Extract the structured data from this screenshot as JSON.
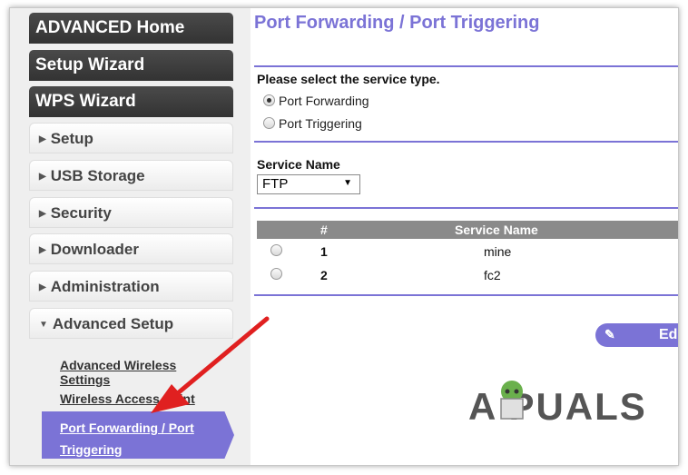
{
  "sidebar": {
    "top_buttons": [
      "ADVANCED Home",
      "Setup Wizard",
      "WPS Wizard"
    ],
    "menu": [
      "Setup",
      "USB Storage",
      "Security",
      "Downloader",
      "Administration"
    ],
    "advanced_setup": "Advanced Setup",
    "submenu": {
      "adv_wireless_1": "Advanced Wireless",
      "adv_wireless_2": "Settings",
      "wireless_ap": "Wireless Access Point",
      "port_fwd_1": "Port Forwarding / Port",
      "port_fwd_2": "Triggering"
    }
  },
  "main": {
    "title": "Port Forwarding / Port Triggering",
    "service_type_label": "Please select the service type.",
    "radio_options": [
      "Port Forwarding",
      "Port Triggering"
    ],
    "selected_option": "Port Forwarding",
    "service_name_label": "Service Name",
    "service_name_value": "FTP",
    "table": {
      "headers": [
        "#",
        "Service Name"
      ],
      "rows": [
        {
          "num": "1",
          "name": "mine"
        },
        {
          "num": "2",
          "name": "fc2"
        }
      ]
    },
    "edit_label": "Edit"
  },
  "watermark": "A  PUALS",
  "colors": {
    "accent": "#7b73d6",
    "annotation_arrow": "#e02020"
  },
  "icons": {
    "menu_collapsed": "triangle-right-icon",
    "menu_expanded": "triangle-down-icon",
    "edit": "pencil-icon"
  }
}
